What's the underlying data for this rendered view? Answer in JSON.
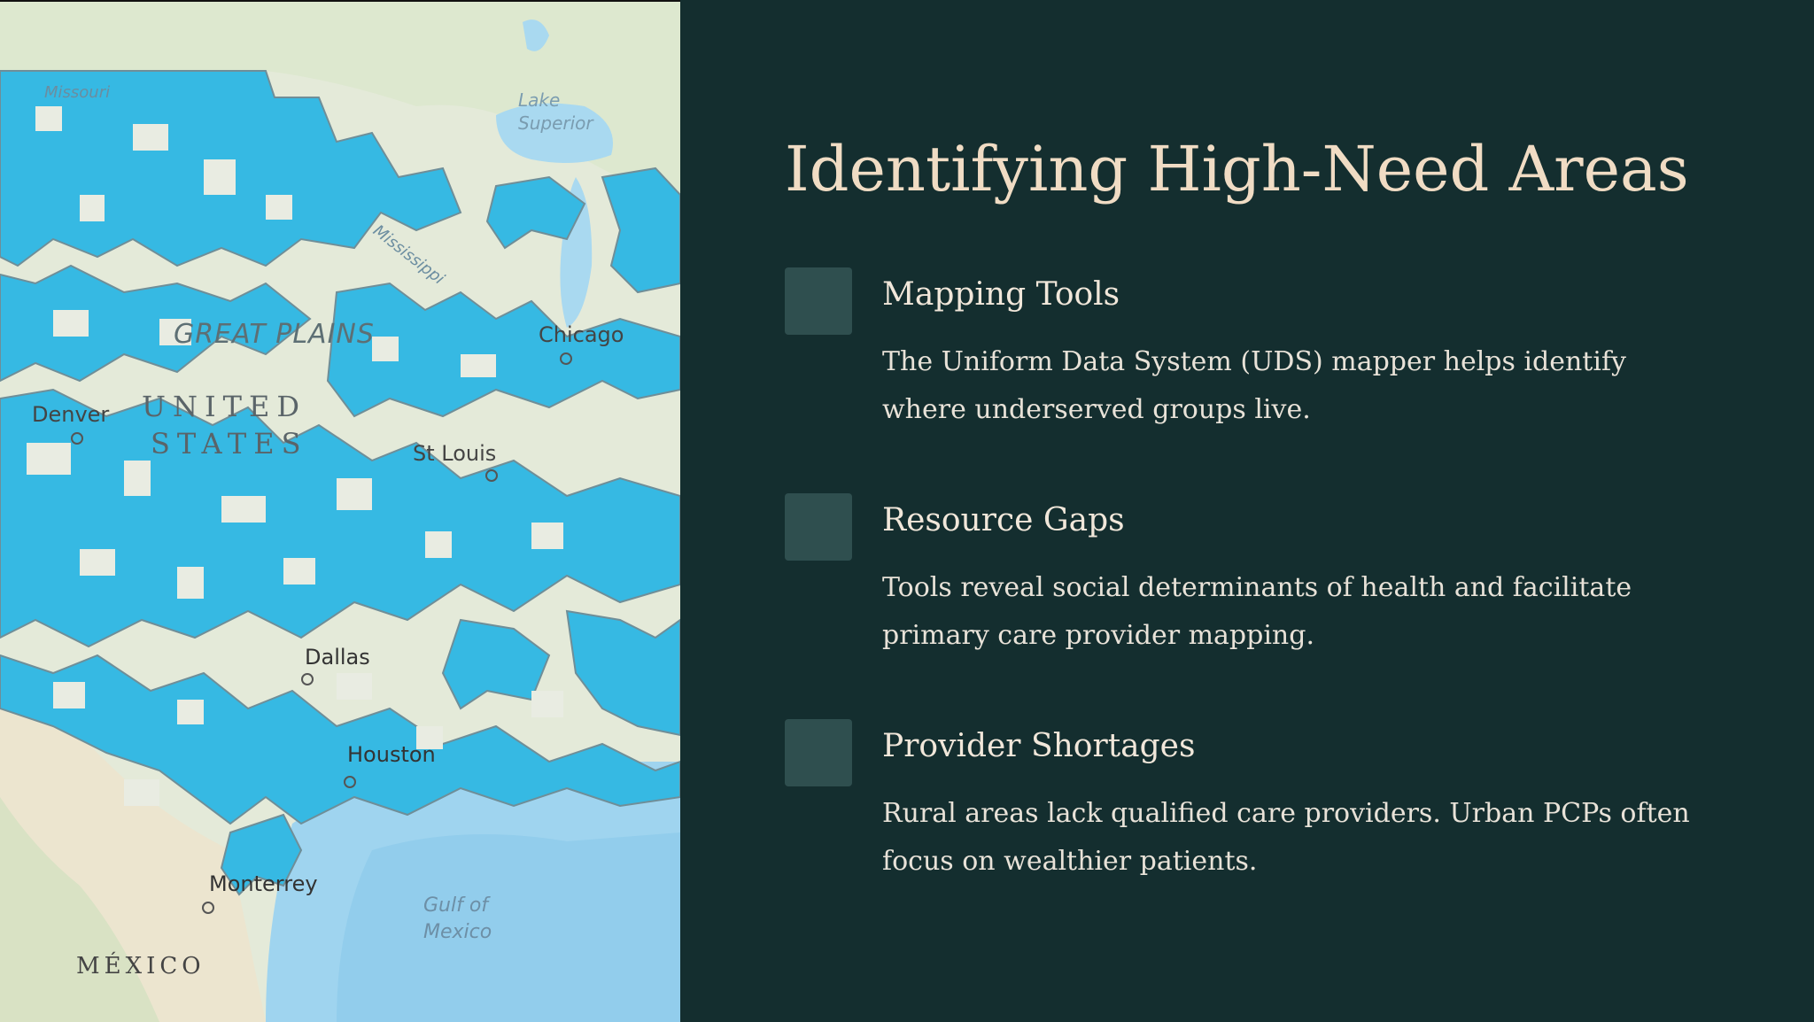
{
  "map": {
    "labels": {
      "lake_superior": "Lake Superior",
      "missouri": "Missouri",
      "mississippi": "Mississippi",
      "great_plains": "GREAT PLAINS",
      "chicago": "Chicago",
      "denver": "Denver",
      "united": "UNITED",
      "states": "STATES",
      "st_louis": "St Louis",
      "dallas": "Dallas",
      "houston": "Houston",
      "monterrey": "Monterrey",
      "gulf_of": "Gulf of",
      "mexico_gulf": "Mexico",
      "mexico_country": "MÉXICO"
    },
    "colors": {
      "highlight": "#36b9e3",
      "border": "#6f8e98",
      "land": "#e9ece2",
      "water": "#9fd4ef"
    }
  },
  "slide": {
    "title": "Identifying High-Need Areas",
    "items": [
      {
        "title": "Mapping Tools",
        "description": "The Uniform Data System (UDS) mapper helps identify where underserved groups live."
      },
      {
        "title": "Resource Gaps",
        "description": "Tools reveal social determinants of health and facilitate primary care provider mapping."
      },
      {
        "title": "Provider Shortages",
        "description": "Rural areas lack qualified care providers. Urban PCPs often focus on wealthier patients."
      }
    ]
  },
  "colors": {
    "background": "#142e2f",
    "title": "#f0dcc4",
    "marker": "#2f4f4f",
    "text": "#e8e2d8"
  }
}
